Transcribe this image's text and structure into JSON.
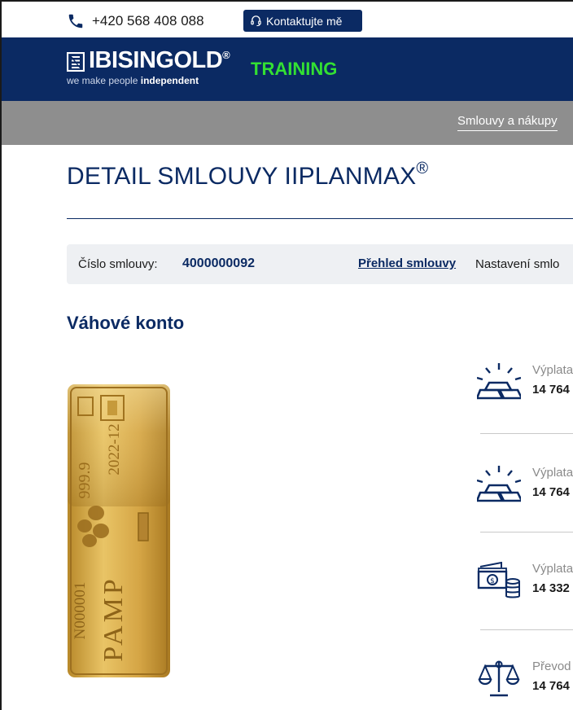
{
  "topbar": {
    "phone": "+420 568 408 088",
    "contact_button": "Kontaktujte mě"
  },
  "brand": {
    "logo": "IBISINGOLD",
    "registered": "®",
    "tagline_prefix": "we make people ",
    "tagline_bold": "independent",
    "environment": "TRAINING"
  },
  "nav": {
    "items": [
      {
        "label": "Smlouvy a nákupy"
      }
    ]
  },
  "page": {
    "title": "DETAIL SMLOUVY IIPLANMAX",
    "title_mark": "®"
  },
  "contract": {
    "number_label": "Číslo smlouvy:",
    "number_value": "4000000092",
    "tabs": [
      {
        "label": "Přehled smlouvy"
      },
      {
        "label": "Nastavení smlo"
      }
    ]
  },
  "section": {
    "title": "Váhové konto"
  },
  "gold_bar": {
    "purity": "999.9",
    "year": "2022-12",
    "serial": "N000001",
    "brand": "PAMP"
  },
  "stats": [
    {
      "icon": "gold-bar-shine-icon",
      "label": "Výplata",
      "value": "14 764"
    },
    {
      "icon": "gold-bar-shine-icon",
      "label": "Výplata",
      "value": "14 764"
    },
    {
      "icon": "cash-coins-icon",
      "label": "Výplata",
      "value": "14 332"
    },
    {
      "icon": "scales-icon",
      "label": "Převod",
      "value": "14 764"
    }
  ],
  "colors": {
    "navy": "#0b2a63",
    "training_green": "#33e033",
    "nav_grey": "#8e8e8e",
    "contract_bar_bg": "#eef0f3",
    "gold": "#d4a83a"
  }
}
